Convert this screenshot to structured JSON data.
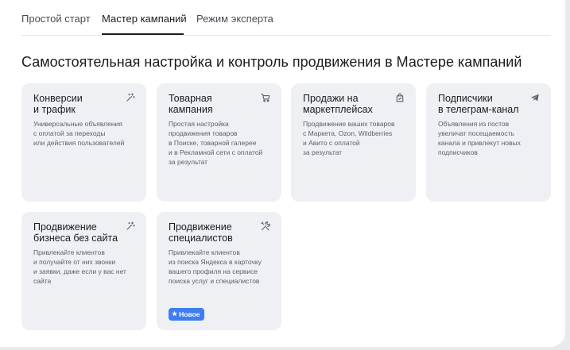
{
  "tabs": [
    {
      "label": "Простой старт"
    },
    {
      "label": "Мастер кампаний"
    },
    {
      "label": "Режим эксперта"
    }
  ],
  "heading": "Самостоятельная настройка и контроль продвижения в Мастере кампаний",
  "cards": [
    {
      "title": "Конверсии\nи трафик",
      "description": "Универсальные объявления\nс оплатой за переходы\nили действия пользователей",
      "icon": "magic-wand-icon"
    },
    {
      "title": "Товарная\nкампания",
      "description": "Простая настройка\nпродвижения товаров\nв Поиске, товарной галерее\nи в Рекламной сети с оплатой\nза результат",
      "icon": "shopping-cart-icon"
    },
    {
      "title": "Продажи на\nмаркетплейсах",
      "description": "Продвижение ваших товаров\nс Маркета, Ozon, Wildberries\nи Авито с оплатой\nза результат",
      "icon": "shopping-bag-icon"
    },
    {
      "title": "Подписчики\nв телеграм-канал",
      "description": "Объявления из постов\nувеличат посещаемость\nканала и привлекут новых\nподписчиков",
      "icon": "telegram-plane-icon"
    },
    {
      "title": "Продвижение\nбизнеса без сайта",
      "description": "Привлекайте клиентов\nи получайте от них звонки\nи заявки, даже если у вас нет\nсайта",
      "icon": "magic-wand-icon"
    },
    {
      "title": "Продвижение\nспециалистов",
      "description": "Привлекайте клиентов\nиз поиска Яндекса в карточку\nвашего профиля на сервисе\nпоиска услуг и специалистов",
      "icon": "tools-icon",
      "badge": "Новое"
    }
  ],
  "colors": {
    "accent": "#3d7df2",
    "card_background": "#eef0f4"
  }
}
